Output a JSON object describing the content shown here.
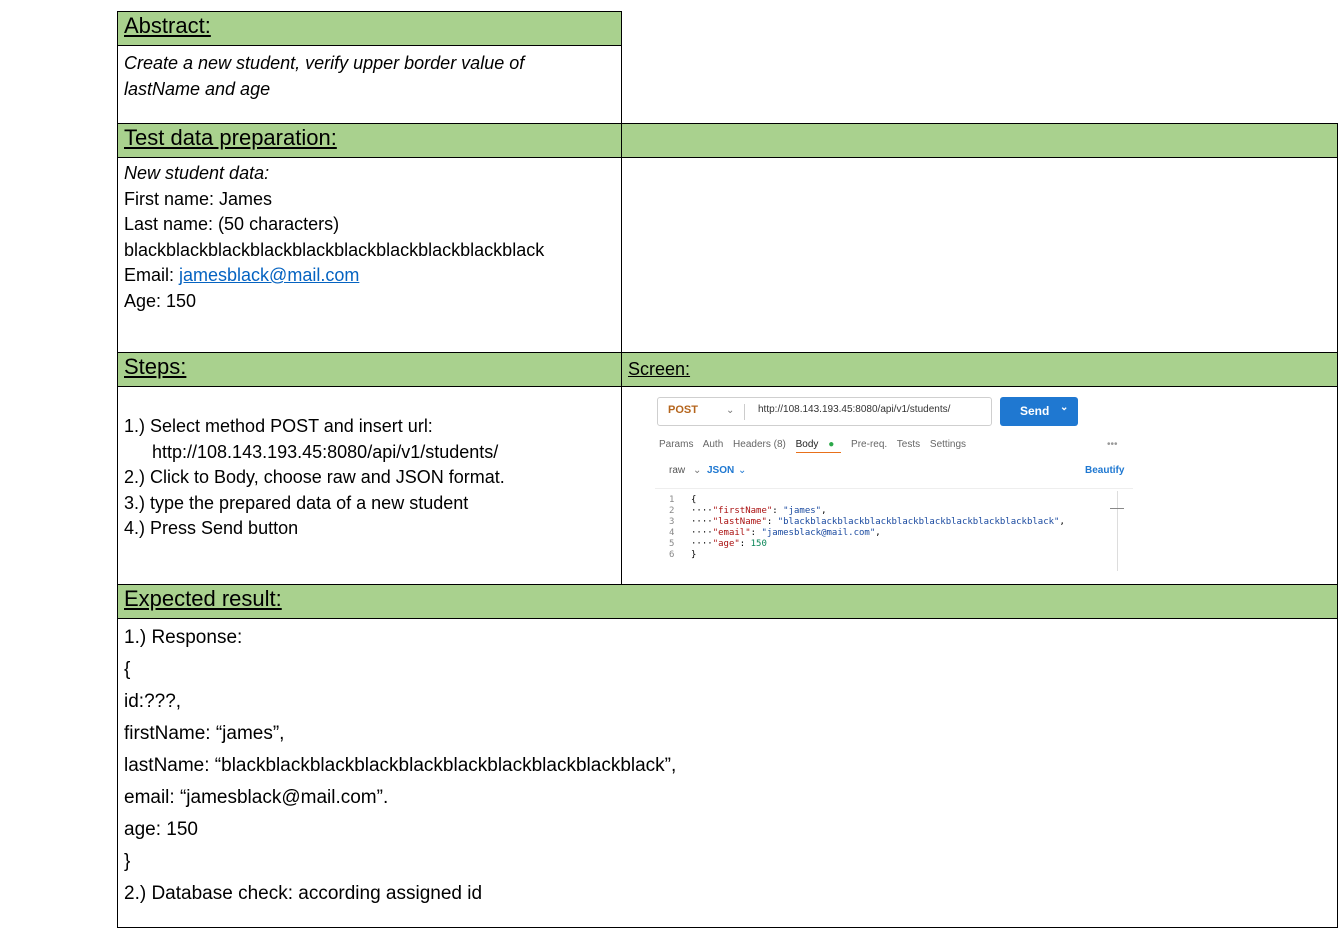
{
  "abstract": {
    "heading": "Abstract:",
    "text_line1": "Create a new student, verify upper border value of",
    "text_line2": "lastName and age"
  },
  "test_data": {
    "heading": "Test data preparation:",
    "lines": {
      "intro": "New student data:",
      "first_name": "First name: James",
      "last_name": "Last name: (50 characters)",
      "last_name_value": "blackblackblackblackblackblackblackblackblackblack",
      "email_label": "Email: ",
      "email_value": "jamesblack@mail.com",
      "age": "Age: 150"
    }
  },
  "steps": {
    "heading": "Steps:",
    "screen_heading": "Screen:",
    "items": [
      "1.) Select method POST and insert url:",
      "http://108.143.193.45:8080/api/v1/students/",
      "2.) Click to Body, choose raw and JSON format.",
      "3.) type the prepared data of a new student",
      "4.) Press Send button"
    ]
  },
  "postman": {
    "method": "POST",
    "url": "http://108.143.193.45:8080/api/v1/students/",
    "send_label": "Send",
    "tabs": [
      "Params",
      "Auth",
      "Headers (8)",
      "Body",
      "Pre-req.",
      "Tests",
      "Settings"
    ],
    "more": "•••",
    "body_mode": "raw",
    "format": "JSON",
    "beautify": "Beautify",
    "code_lines": {
      "l1": "{",
      "l2k": "\"firstName\"",
      "l2v": "\"james\"",
      "l3k": "\"lastName\"",
      "l3v": "\"blackblackblackblackblackblackblackblackblackblack\"",
      "l4k": "\"email\"",
      "l4v": "\"jamesblack@mail.com\"",
      "l5k": "\"age\"",
      "l5v": "150",
      "l6": "}"
    },
    "colors": {
      "accent": "#1f78d1",
      "method": "#b5651d",
      "body_dot": "#2ba84a"
    }
  },
  "expected": {
    "heading": "Expected result:",
    "lines": [
      "1.) Response:",
      "{",
      "id:???,",
      "firstName: “james”,",
      "lastName: “blackblackblackblackblackblackblackblackblackblack”,",
      "email: “jamesblack@mail.com”.",
      "age: 150",
      "}",
      "2.) Database check: according assigned id"
    ]
  },
  "colors": {
    "header_bg": "#a9d18e",
    "link": "#0563c1"
  }
}
